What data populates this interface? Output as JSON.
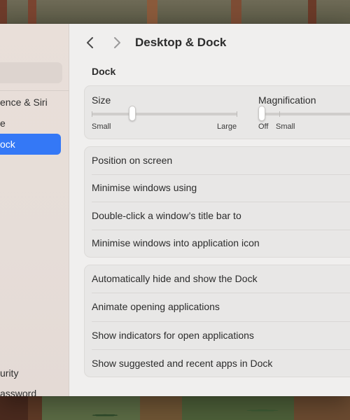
{
  "window": {
    "title": "Desktop & Dock"
  },
  "sidebar": {
    "items": [
      {
        "label": "ence & Siri",
        "selected": false
      },
      {
        "label": "e",
        "selected": false
      },
      {
        "label": "ock",
        "selected": true
      },
      {
        "label": "urity",
        "selected": false
      },
      {
        "label": "assword",
        "selected": false
      }
    ]
  },
  "dock": {
    "section_label": "Dock",
    "size": {
      "label": "Size",
      "min_label": "Small",
      "max_label": "Large",
      "value": 0.28
    },
    "magnification": {
      "label": "Magnification",
      "off_label": "Off",
      "small_label": "Small",
      "value": 0.0
    }
  },
  "group1": [
    "Position on screen",
    "Minimise windows using",
    "Double-click a window’s title bar to",
    "Minimise windows into application icon"
  ],
  "group2": [
    "Automatically hide and show the Dock",
    "Animate opening applications",
    "Show indicators for open applications",
    "Show suggested and recent apps in Dock"
  ],
  "colors": {
    "accent": "#3478f6"
  }
}
